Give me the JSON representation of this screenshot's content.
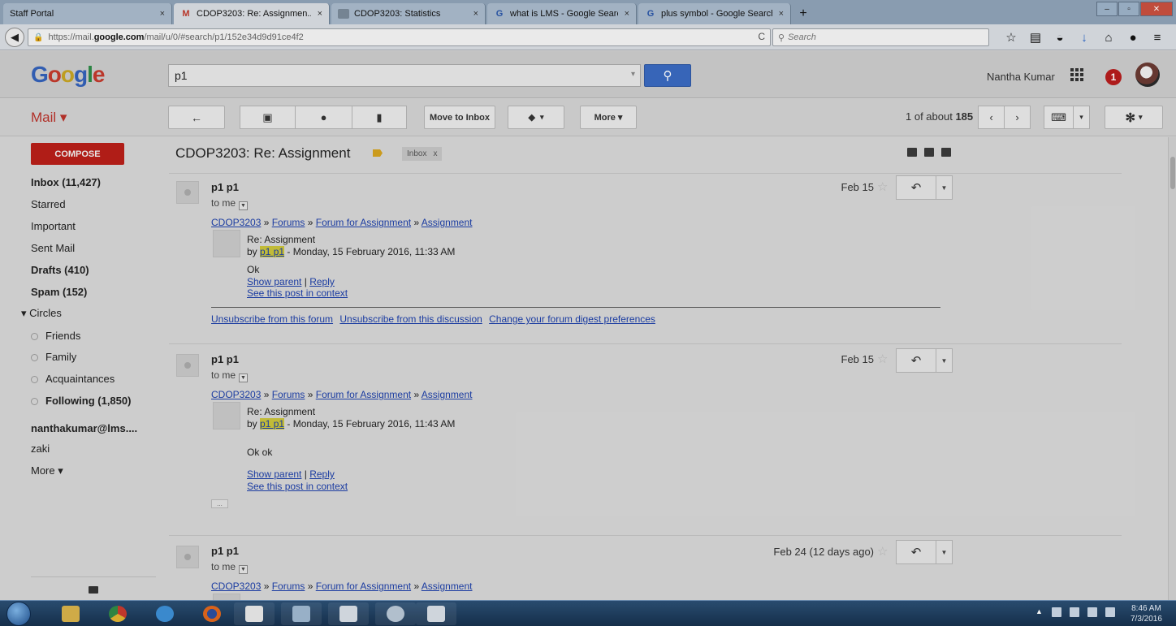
{
  "browser": {
    "tabs": [
      {
        "title": "Staff Portal",
        "close": "×"
      },
      {
        "title": "CDOP3203: Re: Assignmen...",
        "close": "×",
        "icon": "M"
      },
      {
        "title": "CDOP3203: Statistics",
        "close": "×"
      },
      {
        "title": "what is LMS - Google Search",
        "close": "×",
        "icon": "G"
      },
      {
        "title": "plus symbol - Google Search",
        "close": "×",
        "icon": "G"
      }
    ],
    "new_tab": "+",
    "url_prefix": "https://mail.",
    "url_domain": "google.com",
    "url_path": "/mail/u/0/#search/p1/152e34d9d91ce4f2",
    "search_placeholder": "Search"
  },
  "gmail": {
    "logo": [
      "G",
      "o",
      "o",
      "g",
      "l",
      "e"
    ],
    "search_query": "p1",
    "user_name": "Nantha Kumar",
    "notification_count": "1",
    "mail_label": "Mail ▾",
    "toolbar": {
      "move_to_inbox": "Move to Inbox",
      "more": "More ▾",
      "count_prefix": "1 of about ",
      "count_total": "185"
    }
  },
  "sidebar": {
    "compose": "COMPOSE",
    "items": [
      {
        "label": "Inbox (11,427)",
        "bold": true
      },
      {
        "label": "Starred",
        "bold": false
      },
      {
        "label": "Important",
        "bold": false
      },
      {
        "label": "Sent Mail",
        "bold": false
      },
      {
        "label": "Drafts (410)",
        "bold": true
      },
      {
        "label": "Spam (152)",
        "bold": true
      },
      {
        "label": "▾ Circles",
        "bold": false
      },
      {
        "label": "Friends",
        "bold": false
      },
      {
        "label": "Family",
        "bold": false
      },
      {
        "label": "Acquaintances",
        "bold": false
      },
      {
        "label": "Following (1,850)",
        "bold": true
      },
      {
        "label": "nanthakumar@lms....",
        "bold": true
      },
      {
        "label": "zaki",
        "bold": false
      },
      {
        "label": "More ▾",
        "bold": false
      }
    ]
  },
  "thread": {
    "subject": "CDOP3203: Re: Assignment",
    "inbox_chip": "Inbox",
    "inbox_chip_x": "x",
    "messages": [
      {
        "sender": "p1 p1",
        "to": "to me",
        "date": "Feb 15",
        "crumbs": [
          "CDOP3203",
          "Forums",
          "Forum for Assignment",
          "Assignment"
        ],
        "post_title": "Re: Assignment",
        "by": "by ",
        "author": "p1 p1",
        "when": " - Monday, 15 February 2016, 11:33 AM",
        "text": "Ok",
        "show_parent": "Show parent",
        "reply": "Reply",
        "see_context": "See this post in context",
        "footer": [
          "Unsubscribe from this forum",
          "Unsubscribe from this discussion",
          "Change your forum digest preferences"
        ]
      },
      {
        "sender": "p1 p1",
        "to": "to me",
        "date": "Feb 15",
        "crumbs": [
          "CDOP3203",
          "Forums",
          "Forum for Assignment",
          "Assignment"
        ],
        "post_title": "Re: Assignment",
        "by": "by ",
        "author": "p1 p1",
        "when": " - Monday, 15 February 2016, 11:43 AM",
        "text": "Ok ok",
        "show_parent": "Show parent",
        "reply": "Reply",
        "see_context": "See this post in context",
        "ellipsis": "..."
      },
      {
        "sender": "p1 p1",
        "to": "to me",
        "date": "Feb 24 (12 days ago)",
        "crumbs": [
          "CDOP3203",
          "Forums",
          "Forum for Assignment",
          "Assignment"
        ]
      }
    ],
    "crumb_sep": " » ",
    "link_sep": " | "
  },
  "taskbar": {
    "time": "8:46 AM",
    "date": "7/3/2016"
  }
}
